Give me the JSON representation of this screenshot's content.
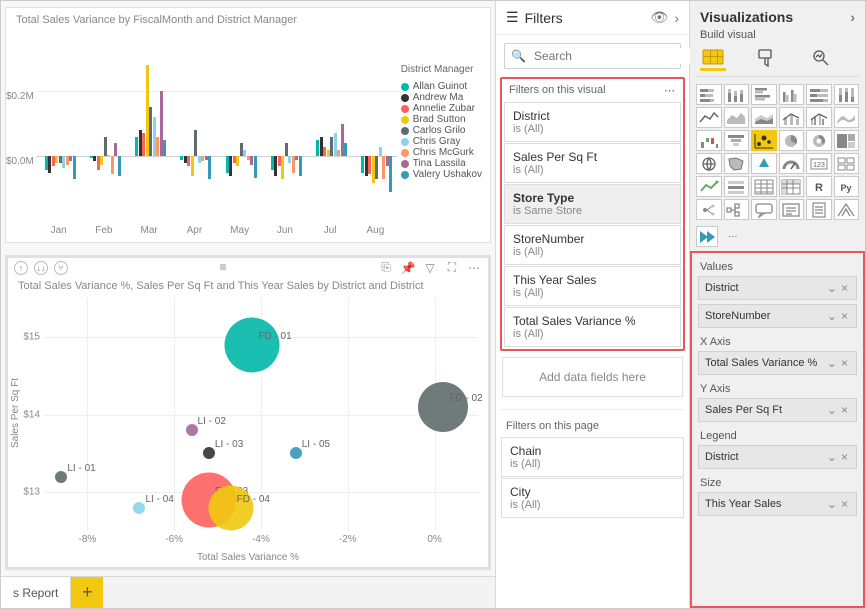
{
  "colors": {
    "allan": "#01b8aa",
    "andrew": "#333333",
    "annelie": "#fd625e",
    "brad": "#f2c80f",
    "carlos": "#5f6b6d",
    "chrisg": "#8ad4eb",
    "chrism": "#fe9666",
    "tina": "#a66999",
    "valery": "#3599b8"
  },
  "chart1": {
    "title": "Total Sales Variance by FiscalMonth and District Manager",
    "legend_title": "District Manager",
    "legend": [
      {
        "key": "allan",
        "name": "Allan Guinot"
      },
      {
        "key": "andrew",
        "name": "Andrew Ma"
      },
      {
        "key": "annelie",
        "name": "Annelie Zubar"
      },
      {
        "key": "brad",
        "name": "Brad Sutton"
      },
      {
        "key": "carlos",
        "name": "Carlos Grilo"
      },
      {
        "key": "chrisg",
        "name": "Chris Gray"
      },
      {
        "key": "chrism",
        "name": "Chris McGurk"
      },
      {
        "key": "tina",
        "name": "Tina Lassila"
      },
      {
        "key": "valery",
        "name": "Valery Ushakov"
      }
    ],
    "yticks": [
      "$0.2M",
      "$0.0M"
    ],
    "categories": [
      "Jan",
      "Feb",
      "Mar",
      "Apr",
      "May",
      "Jun",
      "Jul",
      "Aug"
    ]
  },
  "chart_data": [
    {
      "type": "bar",
      "title": "Total Sales Variance by FiscalMonth and District Manager",
      "categories": [
        "Jan",
        "Feb",
        "Mar",
        "Apr",
        "May",
        "Jun",
        "Jul",
        "Aug"
      ],
      "ylabel": "",
      "ylim": [
        -200000,
        300000
      ],
      "series": [
        {
          "name": "Allan Guinot",
          "values": [
            -40000,
            -5000,
            60000,
            -10000,
            -50000,
            -40000,
            50000,
            -50000
          ]
        },
        {
          "name": "Andrew Ma",
          "values": [
            -50000,
            -15000,
            80000,
            -20000,
            -60000,
            -60000,
            60000,
            -60000
          ]
        },
        {
          "name": "Annelie Zubar",
          "values": [
            -30000,
            -40000,
            70000,
            -30000,
            -20000,
            -30000,
            30000,
            -55000
          ]
        },
        {
          "name": "Brad Sutton",
          "values": [
            -20000,
            -25000,
            280000,
            -60000,
            -30000,
            -70000,
            20000,
            -80000
          ]
        },
        {
          "name": "Carlos Grilo",
          "values": [
            -20000,
            60000,
            150000,
            80000,
            40000,
            40000,
            60000,
            -70000
          ]
        },
        {
          "name": "Chris Gray",
          "values": [
            -35000,
            5000,
            120000,
            -20000,
            20000,
            -20000,
            70000,
            30000
          ]
        },
        {
          "name": "Chris McGurk",
          "values": [
            -25000,
            -55000,
            60000,
            -15000,
            -10000,
            -50000,
            20000,
            -70000
          ]
        },
        {
          "name": "Tina Lassila",
          "values": [
            -15000,
            40000,
            200000,
            -10000,
            -25000,
            -10000,
            100000,
            -30000
          ]
        },
        {
          "name": "Valery Ushakov",
          "values": [
            -70000,
            -60000,
            50000,
            -70000,
            -65000,
            -60000,
            40000,
            -110000
          ]
        }
      ]
    },
    {
      "type": "scatter",
      "title": "Total Sales Variance %, Sales Per Sq Ft and This Year Sales by District and District",
      "xlabel": "Total Sales Variance %",
      "ylabel": "Sales Per Sq Ft",
      "xlim": [
        -9,
        1
      ],
      "ylim": [
        12.5,
        15.5
      ],
      "series": [
        {
          "name": "FD - 01",
          "x": -4.2,
          "y": 14.9,
          "size": 55
        },
        {
          "name": "FD - 02",
          "x": 0.2,
          "y": 14.1,
          "size": 50
        },
        {
          "name": "FD - 03",
          "x": -5.2,
          "y": 12.9,
          "size": 55
        },
        {
          "name": "FD - 04",
          "x": -4.7,
          "y": 12.8,
          "size": 45
        },
        {
          "name": "LI - 01",
          "x": -8.6,
          "y": 13.2,
          "size": 12
        },
        {
          "name": "LI - 02",
          "x": -5.6,
          "y": 13.8,
          "size": 12
        },
        {
          "name": "LI - 03",
          "x": -5.2,
          "y": 13.5,
          "size": 12
        },
        {
          "name": "LI - 04",
          "x": -6.8,
          "y": 12.8,
          "size": 12
        },
        {
          "name": "LI - 05",
          "x": -3.2,
          "y": 13.5,
          "size": 12
        }
      ]
    }
  ],
  "chart2": {
    "title": "Total Sales Variance %, Sales Per Sq Ft and This Year Sales by District and District",
    "xlabel": "Total Sales Variance %",
    "ylabel": "Sales Per Sq Ft",
    "xticks": [
      "-8%",
      "-6%",
      "-4%",
      "-2%",
      "0%"
    ],
    "yticks": [
      "$13",
      "$14",
      "$15"
    ]
  },
  "tabs": {
    "active": "s Report",
    "add": "+"
  },
  "filters": {
    "title": "Filters",
    "search_placeholder": "Search",
    "sec_visual": "Filters on this visual",
    "add_drop": "Add data fields here",
    "sec_page": "Filters on this page",
    "visual": [
      {
        "name": "District",
        "val": "is (All)",
        "sel": false
      },
      {
        "name": "Sales Per Sq Ft",
        "val": "is (All)",
        "sel": false
      },
      {
        "name": "Store Type",
        "val": "is Same Store",
        "sel": true
      },
      {
        "name": "StoreNumber",
        "val": "is (All)",
        "sel": false
      },
      {
        "name": "This Year Sales",
        "val": "is (All)",
        "sel": false
      },
      {
        "name": "Total Sales Variance %",
        "val": "is (All)",
        "sel": false
      }
    ],
    "page": [
      {
        "name": "Chain",
        "val": "is (All)"
      },
      {
        "name": "City",
        "val": "is (All)"
      }
    ]
  },
  "viz": {
    "title": "Visualizations",
    "subtitle": "Build visual",
    "grid": [
      "stacked-bar",
      "stacked-col",
      "clustered-bar",
      "clustered-col",
      "100-bar",
      "100-col",
      "line",
      "area",
      "stacked-area",
      "line-stacked-col",
      "line-clustered-col",
      "ribbon",
      "waterfall",
      "funnel",
      "scatter",
      "pie",
      "donut",
      "treemap",
      "map",
      "filled-map",
      "azure-map",
      "gauge",
      "card",
      "multi-card",
      "kpi",
      "slicer",
      "table",
      "matrix",
      "r",
      "py",
      "key-infl",
      "decomp",
      "qa",
      "narrative",
      "pag-report",
      "arc",
      "power-apps",
      "power-automate",
      "more"
    ],
    "sections": {
      "values": "Values",
      "xaxis": "X Axis",
      "yaxis": "Y Axis",
      "legend": "Legend",
      "size": "Size"
    },
    "fields": {
      "values": [
        "District",
        "StoreNumber"
      ],
      "xaxis": [
        "Total Sales Variance %"
      ],
      "yaxis": [
        "Sales Per Sq Ft"
      ],
      "legend": [
        "District"
      ],
      "size": [
        "This Year Sales"
      ]
    }
  }
}
